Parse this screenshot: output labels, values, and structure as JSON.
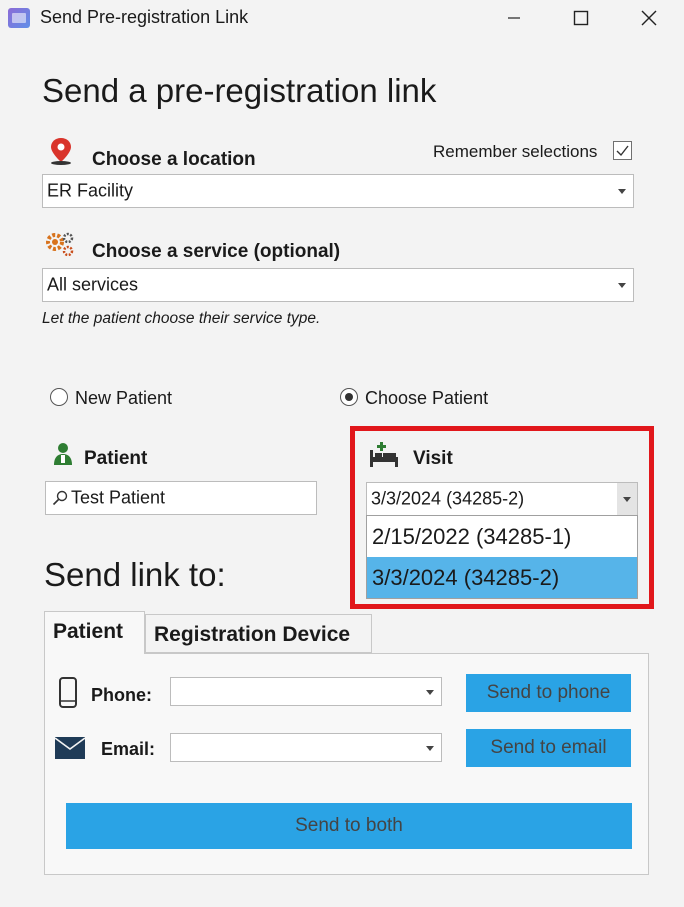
{
  "window": {
    "title": "Send Pre-registration Link"
  },
  "heading": "Send a pre-registration link",
  "location": {
    "label": "Choose a location",
    "value": "ER Facility"
  },
  "remember": {
    "label": "Remember selections",
    "checked": true
  },
  "service": {
    "label": "Choose a service (optional)",
    "value": "All services",
    "hint": "Let the patient choose their service type."
  },
  "patient_mode": {
    "new_label": "New Patient",
    "choose_label": "Choose Patient",
    "selected": "Choose Patient"
  },
  "patient": {
    "label": "Patient",
    "search_value": "Test Patient"
  },
  "visit": {
    "label": "Visit",
    "value": "3/3/2024 (34285-2)",
    "options": [
      "2/15/2022 (34285-1)",
      "3/3/2024 (34285-2)"
    ]
  },
  "send_to": {
    "heading": "Send link to:",
    "tabs": [
      "Patient",
      "Registration Device"
    ],
    "phone_label": "Phone:",
    "email_label": "Email:",
    "phone_value": "",
    "email_value": "",
    "send_phone": "Send to phone",
    "send_email": "Send to email",
    "send_both": "Send to both"
  },
  "colors": {
    "accent": "#2aa3e5",
    "highlight": "#e1171b",
    "selected": "#56b4e9"
  }
}
